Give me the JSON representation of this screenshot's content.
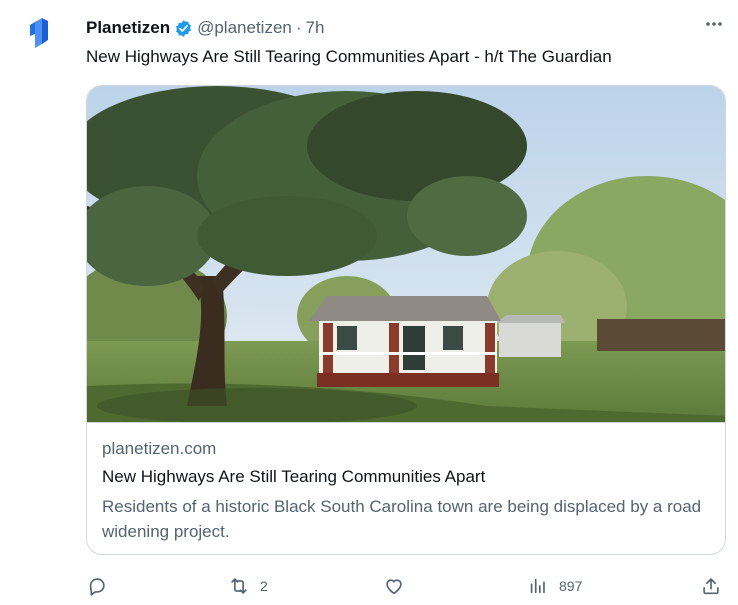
{
  "tweet": {
    "author_name": "Planetizen",
    "handle": "@planetizen",
    "separator": "·",
    "time": "7h",
    "text": "New Highways Are Still Tearing Communities Apart - h/t The Guardian"
  },
  "card": {
    "domain": "planetizen.com",
    "title": "New Highways Are Still Tearing Communities Apart",
    "description": "Residents of a historic Black South Carolina town are being displaced by a road widening project."
  },
  "actions": {
    "reply_count": "",
    "retweet_count": "2",
    "like_count": "",
    "views_count": "897"
  },
  "colors": {
    "verified_badge": "#1d9bf0",
    "avatar_logo": "#1a73e8",
    "secondary_text": "#536471",
    "border": "#cfd9de"
  },
  "icons": [
    "planetizen-logo",
    "verified-badge-icon",
    "more-icon",
    "reply-icon",
    "retweet-icon",
    "like-icon",
    "views-icon",
    "share-icon"
  ]
}
